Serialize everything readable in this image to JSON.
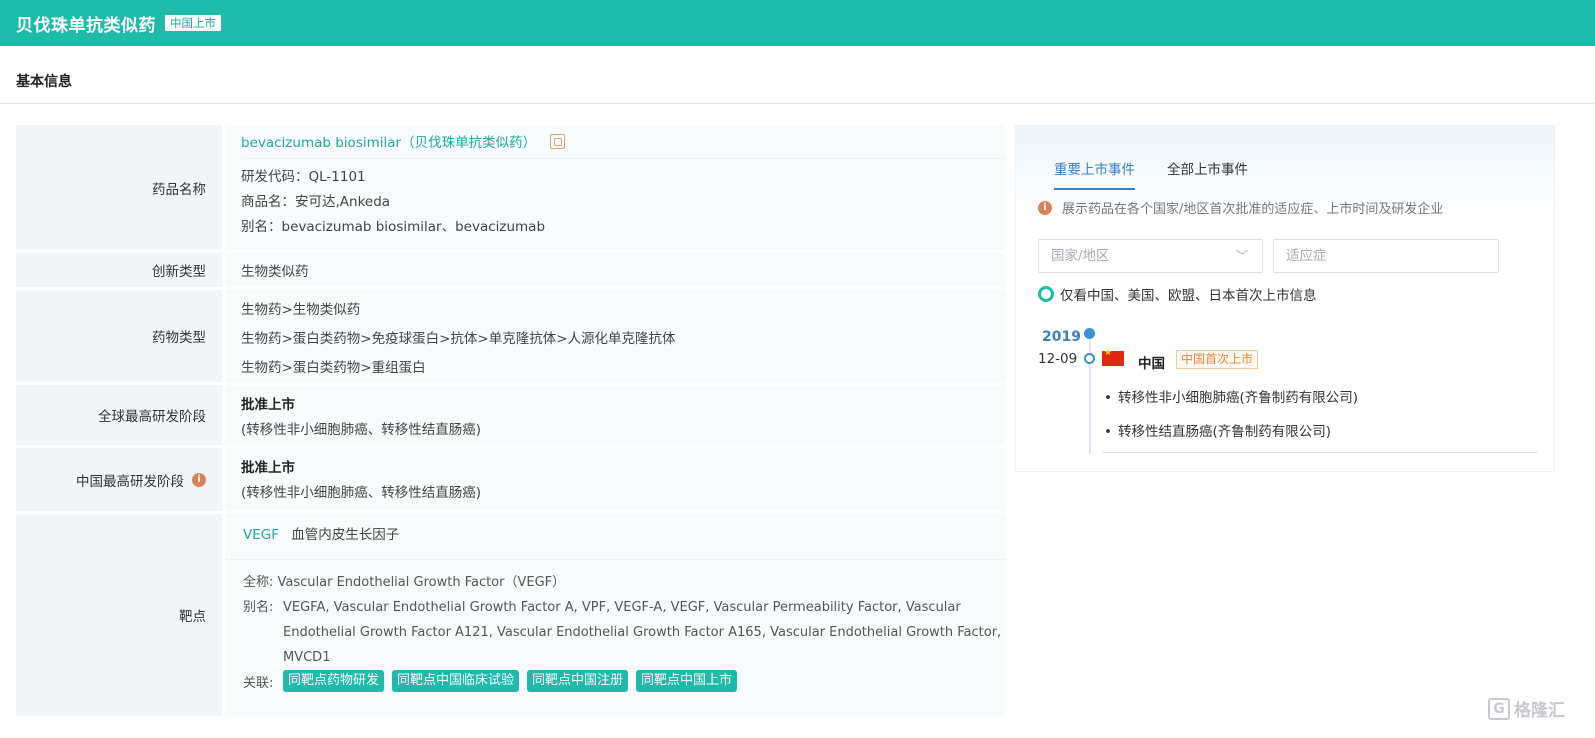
{
  "header": {
    "title": "贝伐珠单抗类似药",
    "badge": "中国上市"
  },
  "section": {
    "title": "基本信息"
  },
  "rows": {
    "drug_name": {
      "label": "药品名称",
      "name_link": "bevacizumab biosimilar（贝伐珠单抗类似药）",
      "code": "研发代码：QL-1101",
      "trade_name": "商品名：安可达,Ankeda",
      "alias": "别名：bevacizumab biosimilar、bevacizumab"
    },
    "innovation": {
      "label": "创新类型",
      "value": "生物类似药"
    },
    "drug_type": {
      "label": "药物类型",
      "values": [
        "生物药>生物类似药",
        "生物药>蛋白类药物>免疫球蛋白>抗体>单克隆抗体>人源化单克隆抗体",
        "生物药>蛋白类药物>重组蛋白"
      ]
    },
    "global_stage": {
      "label": "全球最高研发阶段",
      "stage": "批准上市",
      "detail": "(转移性非小细胞肺癌、转移性结直肠癌)"
    },
    "china_stage": {
      "label": "中国最高研发阶段",
      "stage": "批准上市",
      "detail": "(转移性非小细胞肺癌、转移性结直肠癌)"
    },
    "target": {
      "label": "靶点",
      "symbol": "VEGF",
      "symbol_desc": "血管内皮生长因子",
      "fullname": "全称:  Vascular Endothelial Growth Factor（VEGF）",
      "alias_label": "别名:",
      "alias_lines": [
        "VEGFA, Vascular Endothelial Growth Factor A, VPF, VEGF-A, VEGF, Vascular Permeability Factor, Vascular",
        "Endothelial Growth Factor A121, Vascular Endothelial Growth Factor A165, Vascular Endothelial Growth Factor,",
        "MVCD1"
      ],
      "related_label": "关联:",
      "related_buttons": [
        "同靶点药物研发",
        "同靶点中国临床试验",
        "同靶点中国注册",
        "同靶点中国上市"
      ]
    }
  },
  "panel": {
    "tabs": [
      "重要上市事件",
      "全部上市事件"
    ],
    "hint": "展示药品在各个国家/地区首次批准的适应症、上市时间及研发企业",
    "country_placeholder": "国家/地区",
    "indication_placeholder": "适应症",
    "toggle_label": "仅看中国、美国、欧盟、日本首次上市信息",
    "timeline": {
      "year": "2019",
      "date": "12-09",
      "country": "中国",
      "badge": "中国首次上市",
      "items": [
        "转移性非小细胞肺癌(齐鲁制药有限公司)",
        "转移性结直肠癌(齐鲁制药有限公司)"
      ]
    }
  },
  "watermark": {
    "text": "格隆汇"
  }
}
